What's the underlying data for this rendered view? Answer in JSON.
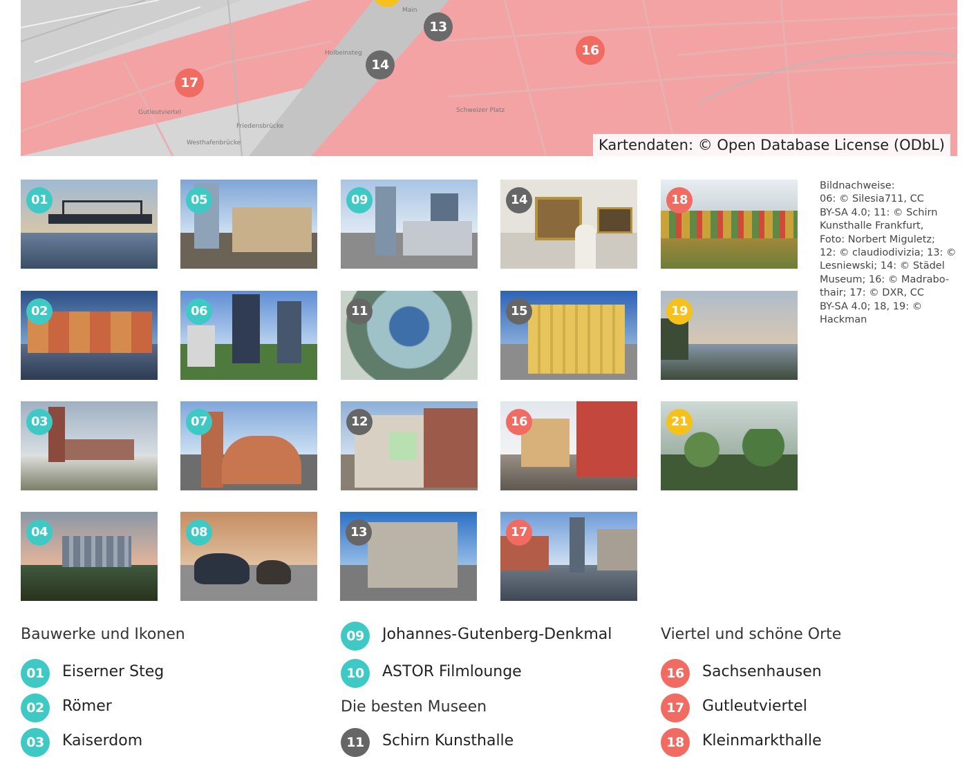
{
  "map": {
    "attribution": "Kartendaten: © Open Database License (ODbL)",
    "street_labels": [
      "Holbeinsteg",
      "Friedensbrücke",
      "Westhafenbrücke",
      "Gutleutviertel",
      "Schweizer Platz",
      "Main"
    ],
    "pins": [
      {
        "number": "13",
        "color": "gray"
      },
      {
        "number": "14",
        "color": "gray"
      },
      {
        "number": "16",
        "color": "red"
      },
      {
        "number": "17",
        "color": "red"
      }
    ]
  },
  "tiles": [
    {
      "number": "01",
      "color": "teal",
      "subject": "bridge"
    },
    {
      "number": "05",
      "color": "teal",
      "subject": "opera"
    },
    {
      "number": "09",
      "color": "teal",
      "subject": "skyline-square"
    },
    {
      "number": "14",
      "color": "gray",
      "subject": "museum-paintings"
    },
    {
      "number": "18",
      "color": "red",
      "subject": "market-hall"
    },
    {
      "number": "02",
      "color": "teal",
      "subject": "roemer"
    },
    {
      "number": "06",
      "color": "teal",
      "subject": "towers"
    },
    {
      "number": "11",
      "color": "gray",
      "subject": "glass-dome"
    },
    {
      "number": "15",
      "color": "gray",
      "subject": "goethe-house"
    },
    {
      "number": "19",
      "color": "yellow",
      "subject": "riverbank"
    },
    {
      "number": "03",
      "color": "teal",
      "subject": "cathedral"
    },
    {
      "number": "07",
      "color": "teal",
      "subject": "paulskirche"
    },
    {
      "number": "12",
      "color": "gray",
      "subject": "museum-building"
    },
    {
      "number": "16",
      "color": "red",
      "subject": "old-street"
    },
    {
      "number": "21",
      "color": "yellow",
      "subject": "palm-house"
    },
    {
      "number": "04",
      "color": "teal",
      "subject": "skyline"
    },
    {
      "number": "08",
      "color": "teal",
      "subject": "bull-bear"
    },
    {
      "number": "13",
      "color": "gray",
      "subject": "villa"
    },
    {
      "number": "17",
      "color": "red",
      "subject": "harbour"
    }
  ],
  "credits": [
    "Bildnachweise:",
    "06: © Silesia711, CC",
    "BY-SA 4.0; 11: © Schirn",
    "Kunsthalle Frankfurt,",
    "Foto: Norbert Miguletz;",
    "12: © claudiodivizia; 13: ©",
    "Lesniewski; 14: © Städel",
    "Museum; 16: © Madrabo-",
    "thair; 17: © DXR, CC",
    "BY-SA 4.0; 18, 19: ©",
    "Hackman"
  ],
  "legend": {
    "col1": {
      "heading": "Bauwerke und Ikonen",
      "items": [
        {
          "number": "01",
          "label": "Eiserner Steg"
        },
        {
          "number": "02",
          "label": "Römer"
        },
        {
          "number": "03",
          "label": "Kaiserdom"
        }
      ]
    },
    "col2": {
      "items_top": [
        {
          "number": "09",
          "label": "Johannes-Gutenberg-Denkmal"
        },
        {
          "number": "10",
          "label": "ASTOR Filmlounge"
        }
      ],
      "heading": "Die besten Museen",
      "items_bottom": [
        {
          "number": "11",
          "label": "Schirn Kunsthalle"
        }
      ]
    },
    "col3": {
      "heading": "Viertel und schöne Orte",
      "items": [
        {
          "number": "16",
          "label": "Sachsenhausen"
        },
        {
          "number": "17",
          "label": "Gutleutviertel"
        },
        {
          "number": "18",
          "label": "Kleinmarkthalle"
        }
      ]
    }
  },
  "colors": {
    "teal": "#3ec9c4",
    "gray": "#666666",
    "red": "#f06b62",
    "yellow": "#f6c11a",
    "map_overlay": "#f3a3a3"
  }
}
